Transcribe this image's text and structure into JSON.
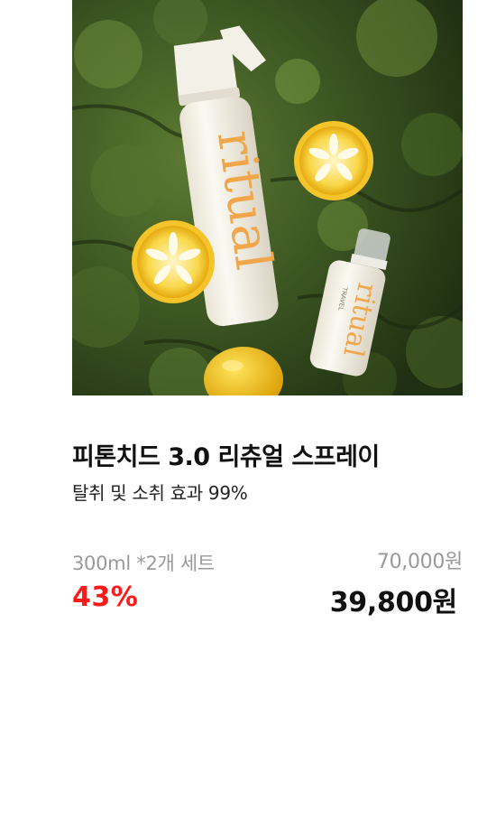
{
  "product": {
    "image": {
      "brand_text": "ritual",
      "small_bottle_label": "TRAVEL",
      "background_color": "#2f4420",
      "accent_color": "#f0a64a"
    },
    "title": "피톤치드 3.0 리츄얼 스프레이",
    "subtitle": "탈취 및 소취 효과 99%",
    "option": "300ml *2개 세트",
    "discount": "43%",
    "original_price": "70,000원",
    "sale_price": "39,800원",
    "colors": {
      "discount": "#ff1a1a",
      "muted": "#999999",
      "text": "#111111"
    }
  }
}
